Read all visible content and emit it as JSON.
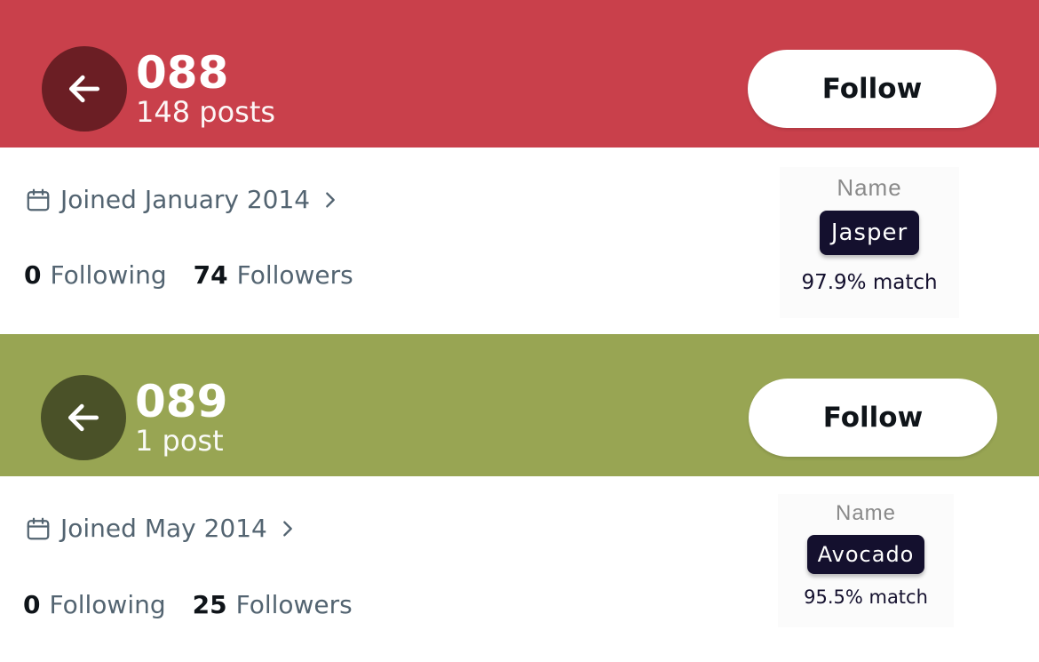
{
  "cards": [
    {
      "banner_color": "#c9404b",
      "back_button_color": "#6b1e24",
      "account_id": "088",
      "posts": "148 posts",
      "follow_label": "Follow",
      "joined": "Joined January 2014",
      "following_count": "0",
      "following_label": "Following",
      "followers_count": "74",
      "followers_label": "Followers",
      "name_heading": "Name",
      "name_value": "Jasper",
      "match": "97.9% match"
    },
    {
      "banner_color": "#98a553",
      "back_button_color": "#4a5128",
      "account_id": "089",
      "posts": "1 post",
      "follow_label": "Follow",
      "joined": "Joined May 2014",
      "following_count": "0",
      "following_label": "Following",
      "followers_count": "25",
      "followers_label": "Followers",
      "name_heading": "Name",
      "name_value": "Avocado",
      "match": "95.5% match"
    }
  ],
  "icons": {
    "back": "arrow-left-icon",
    "calendar": "calendar-icon",
    "chevron": "chevron-right-icon"
  }
}
